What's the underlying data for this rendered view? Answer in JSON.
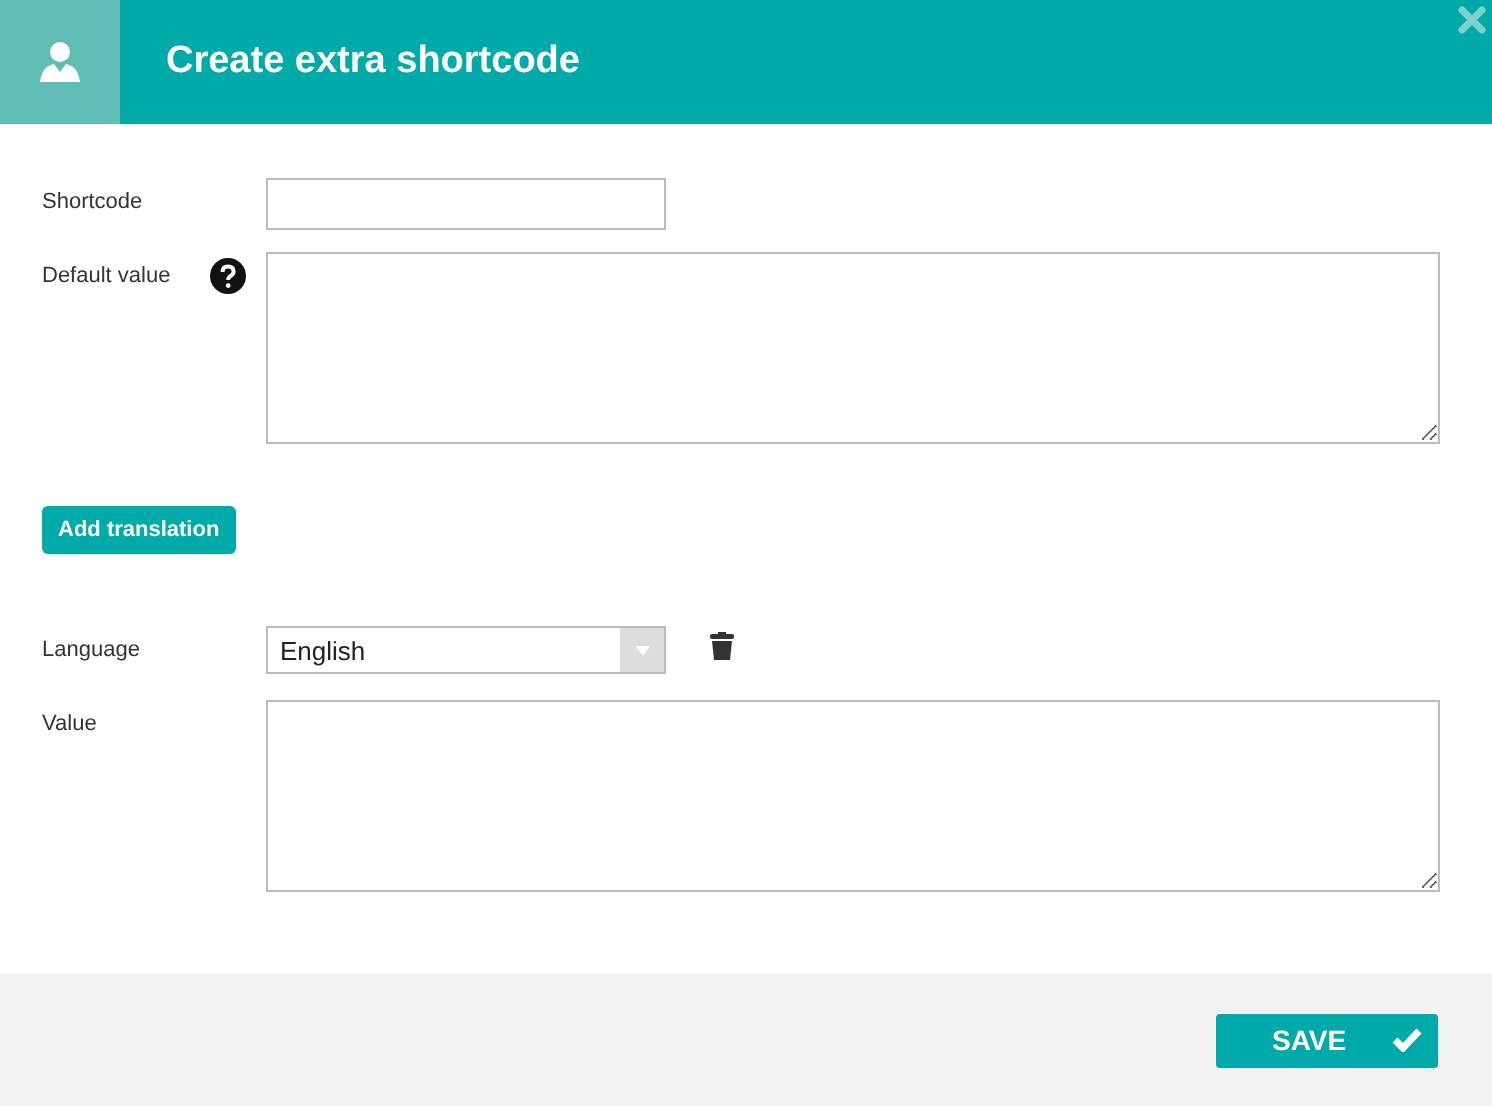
{
  "dialog": {
    "title": "Create extra shortcode"
  },
  "fields": [
    {
      "label": "Shortcode",
      "kind": "input",
      "help": false
    },
    {
      "label": "Default value",
      "kind": "textarea",
      "help": true
    }
  ],
  "add_button": "Add translation",
  "translation": {
    "language_label": "Language",
    "language": "English",
    "value_label": "Value"
  },
  "save_button": "SAVE"
}
